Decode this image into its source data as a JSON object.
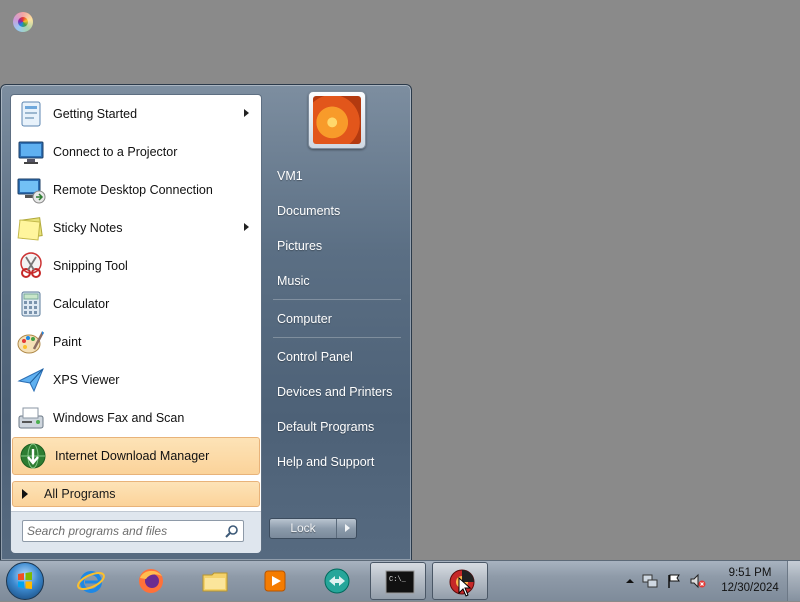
{
  "start_menu": {
    "programs": [
      {
        "label": "Getting Started",
        "icon": "getting-started-icon",
        "has_submenu": true
      },
      {
        "label": "Connect to a Projector",
        "icon": "projector-icon",
        "has_submenu": false
      },
      {
        "label": "Remote Desktop Connection",
        "icon": "remote-desktop-icon",
        "has_submenu": false
      },
      {
        "label": "Sticky Notes",
        "icon": "sticky-notes-icon",
        "has_submenu": true
      },
      {
        "label": "Snipping Tool",
        "icon": "snipping-tool-icon",
        "has_submenu": false
      },
      {
        "label": "Calculator",
        "icon": "calculator-icon",
        "has_submenu": false
      },
      {
        "label": "Paint",
        "icon": "paint-icon",
        "has_submenu": false
      },
      {
        "label": "XPS Viewer",
        "icon": "xps-viewer-icon",
        "has_submenu": false
      },
      {
        "label": "Windows Fax and Scan",
        "icon": "fax-scan-icon",
        "has_submenu": false
      },
      {
        "label": "Internet Download Manager",
        "icon": "idm-icon",
        "has_submenu": false,
        "highlighted": true
      }
    ],
    "all_programs_label": "All Programs",
    "search_placeholder": "Search programs and files",
    "right_items": {
      "user": "VM1",
      "documents": "Documents",
      "pictures": "Pictures",
      "music": "Music",
      "computer": "Computer",
      "control_panel": "Control Panel",
      "devices": "Devices and Printers",
      "default_programs": "Default Programs",
      "help": "Help and Support"
    },
    "lock_label": "Lock"
  },
  "taskbar": {
    "pinned": [
      "internet-explorer-icon",
      "firefox-icon",
      "file-explorer-icon",
      "media-player-icon",
      "teamviewer-icon",
      "command-prompt-icon",
      "app-icon"
    ],
    "cmd_glyph": "C:\\_",
    "clock_time": "9:51 PM",
    "clock_date": "12/30/2024"
  },
  "colors": {
    "highlight": "#fbd39a",
    "menu_frame": "#5b6f84",
    "taskbar": "#8e9aa8"
  }
}
